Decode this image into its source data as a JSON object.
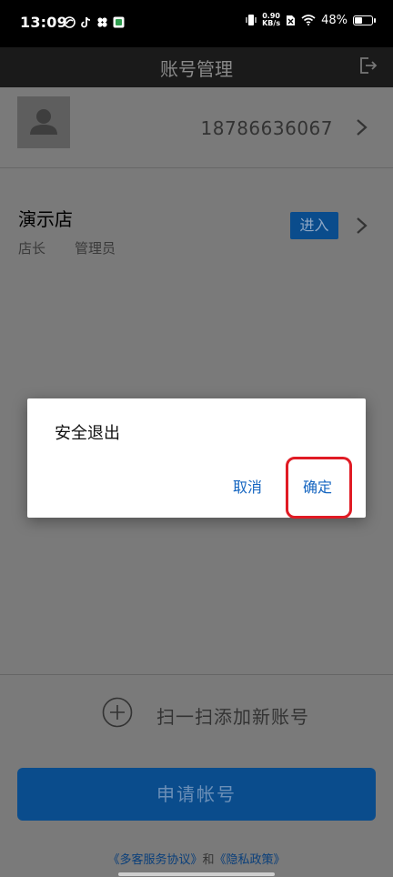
{
  "status_bar": {
    "time": "13:09",
    "net_speed_value": "0.90",
    "net_speed_unit": "KB/s",
    "battery_percent": "48%",
    "battery_level": 0.48
  },
  "header": {
    "title": "账号管理"
  },
  "account": {
    "phone": "18786636067"
  },
  "store": {
    "name": "演示店",
    "role1": "店长",
    "role2": "管理员",
    "enter_label": "进入"
  },
  "dialog": {
    "title": "安全退出",
    "cancel_label": "取消",
    "confirm_label": "确定"
  },
  "bottom": {
    "scan_label": "扫一扫添加新账号",
    "apply_label": "申请帐号",
    "agreement_link1": "《多客服务协议》",
    "agreement_and": "和",
    "agreement_link2": "《隐私政策》"
  },
  "colors": {
    "accent": "#0a4c8c",
    "link": "#1565c0",
    "highlight": "#e01b24"
  }
}
